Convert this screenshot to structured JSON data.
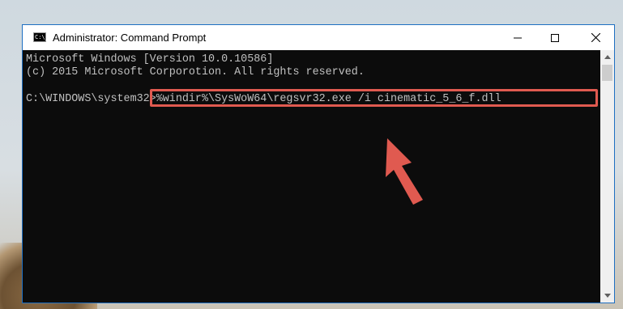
{
  "window": {
    "title": "Administrator: Command Prompt",
    "icon_label": "C:\\_"
  },
  "console": {
    "lines": [
      "Microsoft Windows [Version 10.0.10586]",
      "(c) 2015 Microsoft Corporotion. All rights reserved.",
      ""
    ],
    "prompt": "C:\\WINDOWS\\system32>",
    "command": "%windir%\\SysWoW64\\regsvr32.exe /i cinematic_5_6_f.dll"
  },
  "colors": {
    "console_background": "#0c0c0c",
    "console_text": "#c0c0c0",
    "highlight": "#e05a50"
  },
  "icons": {
    "app": "cmd-icon",
    "minimize": "minimize-icon",
    "maximize": "maximize-icon",
    "close": "close-icon",
    "annotation": "red-arrow-icon"
  }
}
